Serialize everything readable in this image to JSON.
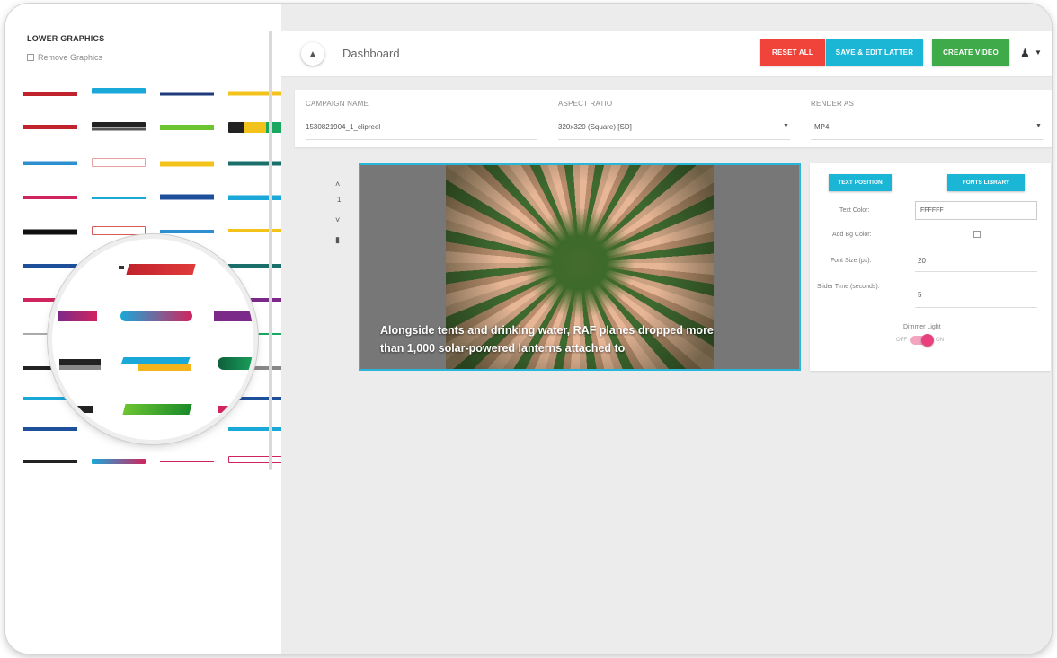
{
  "sidebar": {
    "title": "LOWER GRAPHICS",
    "remove_label": "Remove Graphics"
  },
  "header": {
    "home_icon": "home-icon",
    "breadcrumb": "Dashboard",
    "buttons": {
      "reset": "RESET ALL",
      "save": "SAVE & EDIT LATTER",
      "create": "CREATE VIDEO"
    },
    "user_icon": "user-icon",
    "colors": {
      "reset": "#f0443a",
      "save": "#1bb5d6",
      "create": "#3eaa4a"
    }
  },
  "settings": {
    "campaign_label": "CAMPAIGN NAME",
    "campaign_value": "1530821904_1_clipreel",
    "aspect_label": "ASPECT RATIO",
    "aspect_value": "320x320 (Square) [SD]",
    "render_label": "RENDER AS",
    "render_value": "MP4"
  },
  "editor": {
    "slide_number": "1",
    "caption": "Alongside tents and drinking water, RAF planes dropped more than 1,000 solar-powered lanterns attached to"
  },
  "properties": {
    "text_position_btn": "TEXT POSITION",
    "fonts_library_btn": "FONTS LIBRARY",
    "text_color_label": "Text Color:",
    "text_color_value": "FFFFFF",
    "add_bg_label": "Add Bg Color:",
    "font_size_label": "Font Size (px):",
    "font_size_value": "20",
    "slider_time_label": "Slider Time (seconds):",
    "slider_time_value": "5",
    "dimmer_label": "Dimmer Light",
    "toggle_off": "OFF",
    "toggle_on": "ON"
  }
}
